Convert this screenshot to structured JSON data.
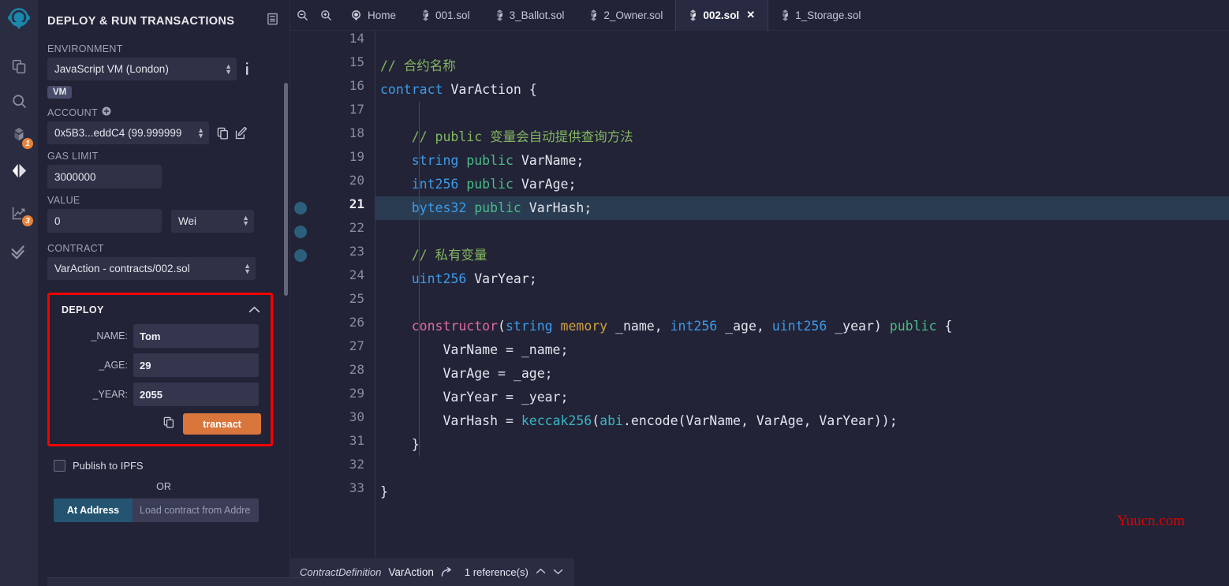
{
  "rail": {
    "logo_name": "remix-logo",
    "items": [
      {
        "name": "file-explorer-icon",
        "badge": null
      },
      {
        "name": "search-icon",
        "badge": null
      },
      {
        "name": "solidity-compiler-icon",
        "badge": "1"
      },
      {
        "name": "deploy-run-icon",
        "badge": null,
        "active": true
      },
      {
        "name": "debugger-icon",
        "badge": "3"
      },
      {
        "name": "plugin-check-icon",
        "badge": null
      }
    ]
  },
  "panel": {
    "title": "DEPLOY & RUN TRANSACTIONS",
    "header_icon": "layout-panel-icon",
    "environment": {
      "label": "ENVIRONMENT",
      "value": "JavaScript VM (London)",
      "info_icon": "info-icon",
      "chip": "VM"
    },
    "account": {
      "label": "ACCOUNT",
      "add_icon": "plus-circle-icon",
      "value": "0x5B3...eddC4 (99.999999",
      "copy_icon": "copy-icon",
      "edit_icon": "edit-icon"
    },
    "gas_limit": {
      "label": "GAS LIMIT",
      "value": "3000000"
    },
    "value": {
      "label": "VALUE",
      "amount": "0",
      "unit": "Wei"
    },
    "contract": {
      "label": "CONTRACT",
      "value": "VarAction - contracts/002.sol"
    },
    "deploy": {
      "title": "DEPLOY",
      "collapse_icon": "chevron-up-icon",
      "args": [
        {
          "label": "_NAME:",
          "value": "Tom"
        },
        {
          "label": "_AGE:",
          "value": "29"
        },
        {
          "label": "_YEAR:",
          "value": "2055"
        }
      ],
      "copy_icon": "copy-icon",
      "transact_label": "transact",
      "border_color": "#f80000",
      "button_color": "#d9763c"
    },
    "publish_ipfs_label": "Publish to IPFS",
    "or_label": "OR",
    "at_address_label": "At Address",
    "at_address_placeholder": "Load contract from Addre"
  },
  "editor": {
    "zoom_out_icon": "zoom-out-icon",
    "zoom_in_icon": "zoom-in-icon",
    "tabs": [
      {
        "label": "Home",
        "icon": "remix-home-icon",
        "active": false,
        "closable": false
      },
      {
        "label": "001.sol",
        "icon": "solidity-icon",
        "active": false,
        "closable": false
      },
      {
        "label": "3_Ballot.sol",
        "icon": "solidity-icon",
        "active": false,
        "closable": false
      },
      {
        "label": "2_Owner.sol",
        "icon": "solidity-icon",
        "active": false,
        "closable": false
      },
      {
        "label": "002.sol",
        "icon": "solidity-icon",
        "active": true,
        "closable": true
      },
      {
        "label": "1_Storage.sol",
        "icon": "solidity-icon",
        "active": false,
        "closable": false
      }
    ],
    "first_line_number": 14,
    "lines": [
      {
        "n": "14",
        "breakpoint": false,
        "highlight": false
      },
      {
        "n": "15",
        "breakpoint": false,
        "highlight": false
      },
      {
        "n": "16",
        "breakpoint": false,
        "highlight": false
      },
      {
        "n": "17",
        "breakpoint": false,
        "highlight": false
      },
      {
        "n": "18",
        "breakpoint": false,
        "highlight": false
      },
      {
        "n": "19",
        "breakpoint": false,
        "highlight": false
      },
      {
        "n": "20",
        "breakpoint": false,
        "highlight": false
      },
      {
        "n": "21",
        "breakpoint": true,
        "highlight": true
      },
      {
        "n": "22",
        "breakpoint": true,
        "highlight": false
      },
      {
        "n": "23",
        "breakpoint": true,
        "highlight": false
      },
      {
        "n": "24",
        "breakpoint": false,
        "highlight": false
      },
      {
        "n": "25",
        "breakpoint": false,
        "highlight": false
      },
      {
        "n": "26",
        "breakpoint": false,
        "highlight": false
      },
      {
        "n": "27",
        "breakpoint": false,
        "highlight": false
      },
      {
        "n": "28",
        "breakpoint": false,
        "highlight": false
      },
      {
        "n": "29",
        "breakpoint": false,
        "highlight": false
      },
      {
        "n": "30",
        "breakpoint": false,
        "highlight": false
      },
      {
        "n": "31",
        "breakpoint": false,
        "highlight": false
      },
      {
        "n": "32",
        "breakpoint": false,
        "highlight": false
      },
      {
        "n": "33",
        "breakpoint": false,
        "highlight": false
      }
    ],
    "code": {
      "l15": "// 合约名称",
      "l16_kw": "contract",
      "l16_name": " VarAction {",
      "l18": "// public 变量会自动提供查询方法",
      "l19_type": "string",
      "l19_pub": "public",
      "l19_id": "VarName;",
      "l20_type": "int256",
      "l20_pub": "public",
      "l20_id": "VarAge;",
      "l21_type": "bytes32",
      "l21_pub": "public",
      "l21_id": "VarHash;",
      "l23": "// 私有变量",
      "l24_type": "uint256",
      "l24_id": "VarYear;",
      "l26_ctor": "constructor",
      "l26_p1": "(",
      "l26_t1": "string",
      "l26_mem": "memory",
      "l26_a1": "_name, ",
      "l26_t2": "int256",
      "l26_a2": " _age, ",
      "l26_t3": "uint256",
      "l26_a3": " _year) ",
      "l26_pub": "public",
      "l26_brace": " {",
      "l27": "VarName = _name;",
      "l28": "VarAge = _age;",
      "l29": "VarYear = _year;",
      "l30_pre": "VarHash = ",
      "l30_fn": "keccak256",
      "l30_p": "(",
      "l30_abi": "abi",
      "l30_rest": ".encode(VarName, VarAge, VarYear));",
      "l31": "}",
      "l33": "}"
    },
    "watermark": "Yuucn.com"
  },
  "status": {
    "kind": "ContractDefinition",
    "name": "VarAction",
    "jump_icon": "jump-to-icon",
    "references": "1 reference(s)",
    "prev_icon": "chevron-up-icon",
    "next_icon": "chevron-down-icon"
  }
}
